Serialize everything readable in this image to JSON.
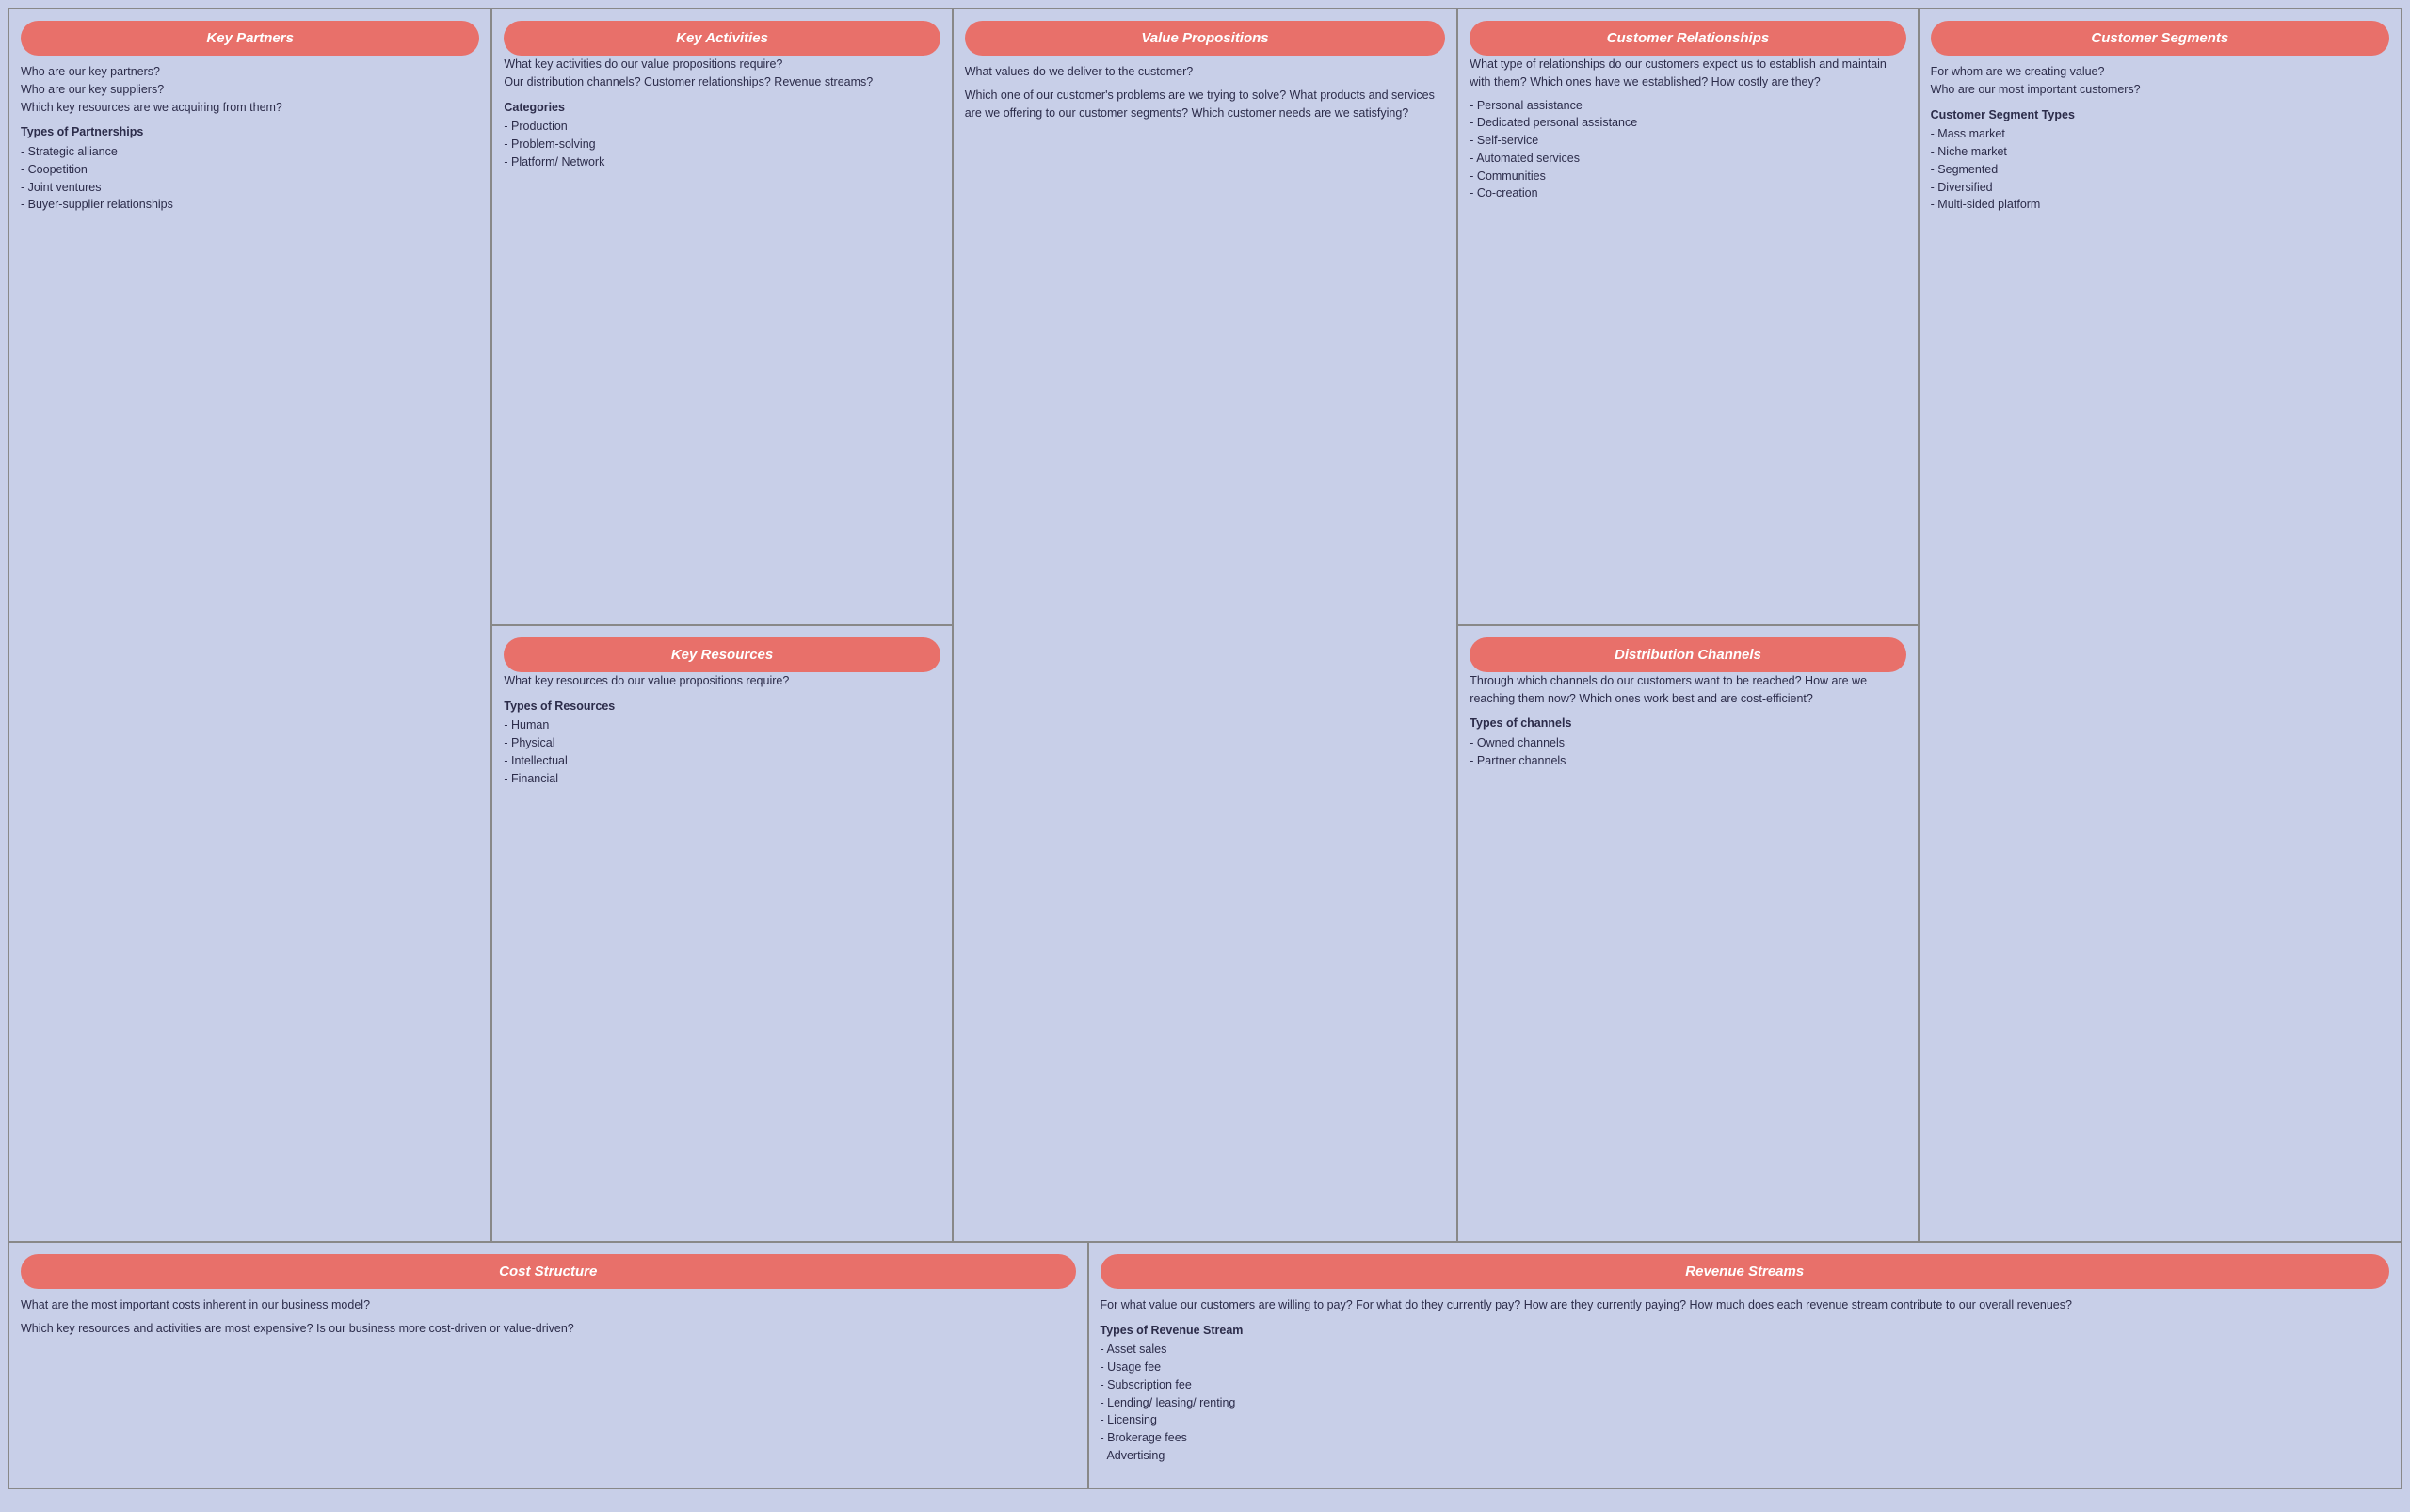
{
  "sections": {
    "keyPartners": {
      "header": "Key Partners",
      "intro": "Who are our key partners?\nWho are our key suppliers?\nWhich key resources are we acquiring from them?",
      "typesLabel": "Types of Partnerships",
      "types": [
        "Strategic alliance",
        "Coopetition",
        "Joint ventures",
        "Buyer-supplier relationships"
      ]
    },
    "keyActivities": {
      "header": "Key Activities",
      "intro": "What key activities do our value propositions require?\nOur distribution channels?  Customer relationships? Revenue streams?",
      "categoriesLabel": "Categories",
      "categories": [
        "Production",
        "Problem-solving",
        "Platform/ Network"
      ]
    },
    "keyResources": {
      "header": "Key Resources",
      "intro": "What key resources do our value propositions require?",
      "typesLabel": "Types of Resources",
      "types": [
        "Human",
        "Physical",
        "Intellectual",
        "Financial"
      ]
    },
    "valuePropositions": {
      "header": "Value Propositions",
      "intro": "What values do we deliver to the customer?\n\nWhich one of our customer's problems are we trying to solve? What products and services are we offering to our customer segments? Which customer needs are we satisfying?"
    },
    "customerRelationships": {
      "header": "Customer Relationships",
      "intro": "What type of relationships do our customers expect us to establish and maintain with them? Which ones have we established? How costly are they?",
      "types": [
        "Personal assistance",
        "Dedicated personal assistance",
        "Self-service",
        "Automated services",
        "Communities",
        "Co-creation"
      ]
    },
    "distributionChannels": {
      "header": "Distribution Channels",
      "intro": "Through which channels do our customers want to be reached? How are we reaching them now? Which ones work best and are cost-efficient?",
      "typesLabel": "Types of channels",
      "types": [
        "Owned channels",
        "Partner channels"
      ]
    },
    "customerSegments": {
      "header": "Customer Segments",
      "intro": "For whom are we creating value?\nWho are our most important customers?",
      "typesLabel": "Customer Segment Types",
      "types": [
        "Mass market",
        "Niche market",
        "Segmented",
        "Diversified",
        "Multi-sided platform"
      ]
    },
    "costStructure": {
      "header": "Cost Structure",
      "line1": "What are the most important costs inherent in our business model?",
      "line2": "Which key resources and activities are most expensive? Is our business more cost-driven or value-driven?"
    },
    "revenueStreams": {
      "header": "Revenue Streams",
      "intro": "For what value our customers are willing to pay? For what do they currently pay? How are they currently paying? How much does each revenue stream contribute to our overall revenues?",
      "typesLabel": "Types of Revenue Stream",
      "types": [
        "Asset sales",
        "Usage fee",
        "Subscription fee",
        "Lending/ leasing/ renting",
        "Licensing",
        "Brokerage fees",
        "Advertising"
      ]
    }
  }
}
